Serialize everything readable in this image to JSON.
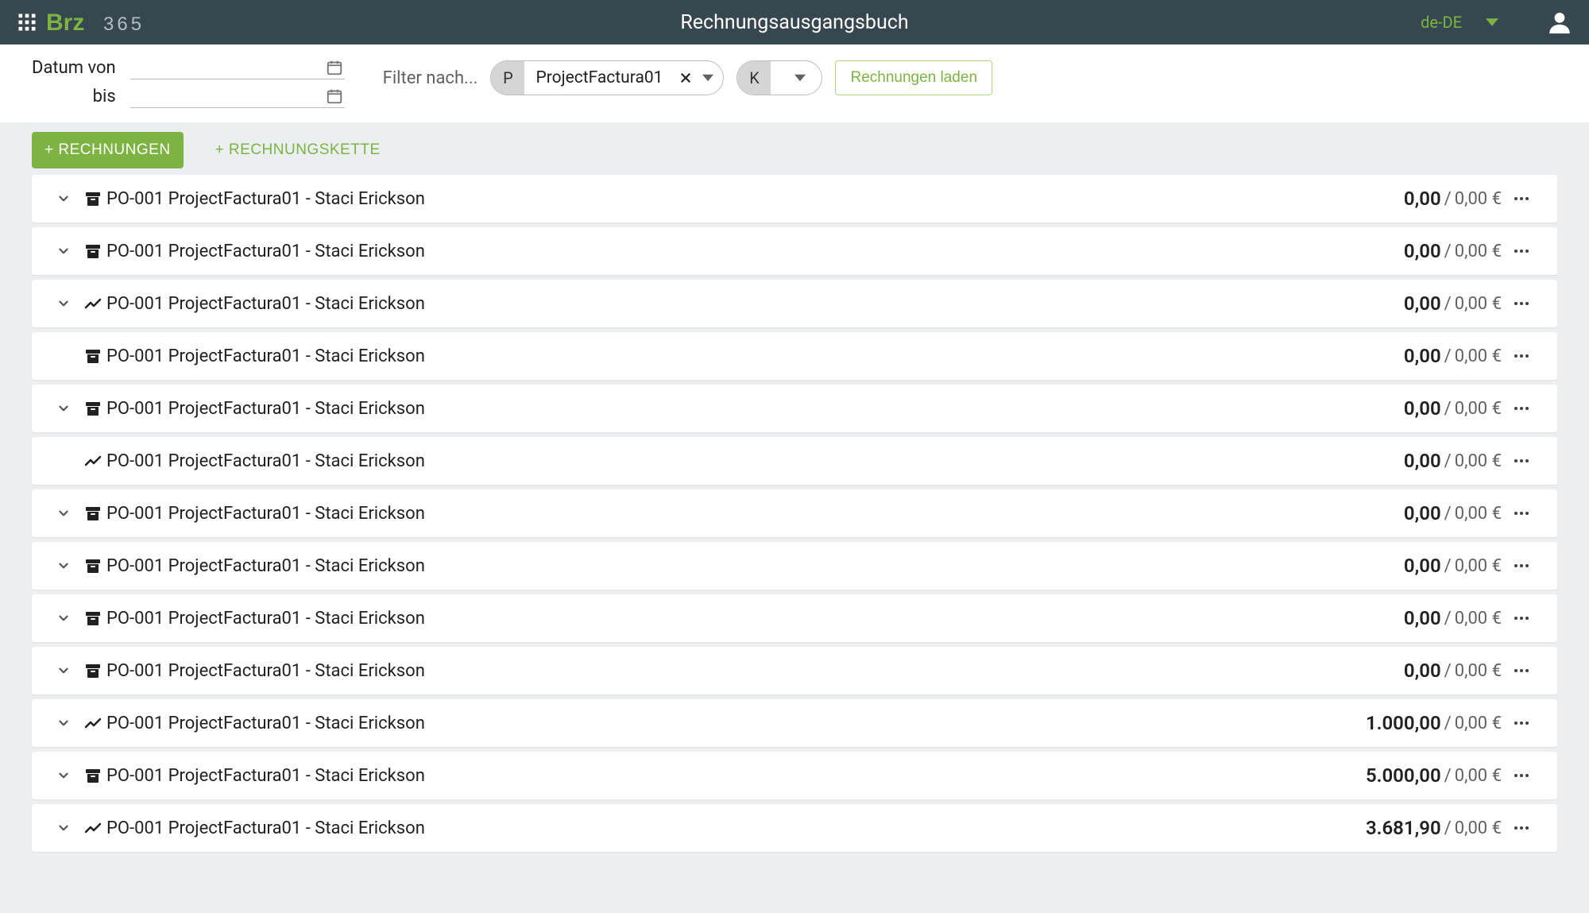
{
  "header": {
    "title": "Rechnungsausgangsbuch",
    "locale": "de-DE"
  },
  "filters": {
    "date_from_label": "Datum von",
    "date_to_label": "bis",
    "filter_label": "Filter nach...",
    "chip_p_prefix": "P",
    "chip_p_value": "ProjectFactura01",
    "chip_k_prefix": "K",
    "load_button": "Rechnungen laden"
  },
  "tabs": {
    "primary": "+ RECHNUNGEN",
    "secondary": "+ RECHNUNGSKETTE"
  },
  "rows": [
    {
      "chevron": true,
      "icon": "archive",
      "text": "PO-001 ProjectFactura01 - Staci Erickson",
      "amt1": "0,00",
      "amt2": "0,00 €"
    },
    {
      "chevron": true,
      "icon": "archive",
      "text": "PO-001 ProjectFactura01 - Staci Erickson",
      "amt1": "0,00",
      "amt2": "0,00 €"
    },
    {
      "chevron": true,
      "icon": "chart",
      "text": "PO-001 ProjectFactura01 - Staci Erickson",
      "amt1": "0,00",
      "amt2": "0,00 €"
    },
    {
      "chevron": false,
      "icon": "archive",
      "text": "PO-001 ProjectFactura01 - Staci Erickson",
      "amt1": "0,00",
      "amt2": "0,00 €"
    },
    {
      "chevron": true,
      "icon": "archive",
      "text": "PO-001 ProjectFactura01 - Staci Erickson",
      "amt1": "0,00",
      "amt2": "0,00 €"
    },
    {
      "chevron": false,
      "icon": "chart",
      "text": "PO-001 ProjectFactura01 - Staci Erickson",
      "amt1": "0,00",
      "amt2": "0,00 €"
    },
    {
      "chevron": true,
      "icon": "archive",
      "text": "PO-001 ProjectFactura01 - Staci Erickson",
      "amt1": "0,00",
      "amt2": "0,00 €"
    },
    {
      "chevron": true,
      "icon": "archive",
      "text": "PO-001 ProjectFactura01 - Staci Erickson",
      "amt1": "0,00",
      "amt2": "0,00 €"
    },
    {
      "chevron": true,
      "icon": "archive",
      "text": "PO-001 ProjectFactura01 - Staci Erickson",
      "amt1": "0,00",
      "amt2": "0,00 €"
    },
    {
      "chevron": true,
      "icon": "archive",
      "text": "PO-001 ProjectFactura01 - Staci Erickson",
      "amt1": "0,00",
      "amt2": "0,00 €"
    },
    {
      "chevron": true,
      "icon": "chart",
      "text": "PO-001 ProjectFactura01 - Staci Erickson",
      "amt1": "1.000,00",
      "amt2": "0,00 €"
    },
    {
      "chevron": true,
      "icon": "archive",
      "text": "PO-001 ProjectFactura01 - Staci Erickson",
      "amt1": "5.000,00",
      "amt2": "0,00 €"
    },
    {
      "chevron": true,
      "icon": "chart",
      "text": "PO-001 ProjectFactura01 - Staci Erickson",
      "amt1": "3.681,90",
      "amt2": "0,00 €"
    }
  ]
}
